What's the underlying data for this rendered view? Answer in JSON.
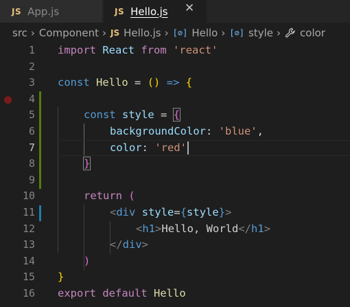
{
  "tabs": [
    {
      "icon": "JS",
      "label": "App.js"
    },
    {
      "icon": "JS",
      "label": "Hello.js",
      "close": "✕"
    }
  ],
  "breadcrumb": {
    "folder": "src",
    "component": "Component",
    "file_icon": "JS",
    "file": "Hello.js",
    "sym_icon": "[⊘]",
    "symbol1": "Hello",
    "symbol2": "style",
    "symbol3": "color"
  },
  "line_numbers": [
    "1",
    "2",
    "3",
    "4",
    "5",
    "6",
    "7",
    "8",
    "9",
    "10",
    "11",
    "12",
    "13",
    "14",
    "15",
    "16"
  ],
  "code": {
    "l1": {
      "a": "import",
      "b": "React",
      "c": "from",
      "d": "'react'"
    },
    "l3": {
      "a": "const",
      "b": "Hello",
      "c": "=",
      "d": "()",
      "e": "=>",
      "f": "{"
    },
    "l5": {
      "a": "const",
      "b": "style",
      "c": "=",
      "d": "{"
    },
    "l6": {
      "a": "backgroundColor",
      "b": ":",
      "c": "'blue'",
      "d": ","
    },
    "l7": {
      "a": "color",
      "b": ":",
      "c": "'red'"
    },
    "l8": {
      "a": "}"
    },
    "l10": {
      "a": "return",
      "b": "("
    },
    "l11": {
      "a": "<",
      "b": "div",
      "c": "style",
      "d": "=",
      "e": "{",
      "f": "style",
      "g": "}",
      "h": ">"
    },
    "l12": {
      "a": "<",
      "b": "h1",
      "c": ">",
      "d": "Hello, World",
      "e": "</",
      "f": "h1",
      "g": ">"
    },
    "l13": {
      "a": "</",
      "b": "div",
      "c": ">"
    },
    "l14": {
      "a": ")"
    },
    "l15": {
      "a": "}"
    },
    "l16": {
      "a": "export",
      "b": "default",
      "c": "Hello"
    }
  },
  "icons": {
    "breakpoint": "breakpoint-icon",
    "wrench": "wrench-icon",
    "symbol": "symbol-variable-icon"
  }
}
